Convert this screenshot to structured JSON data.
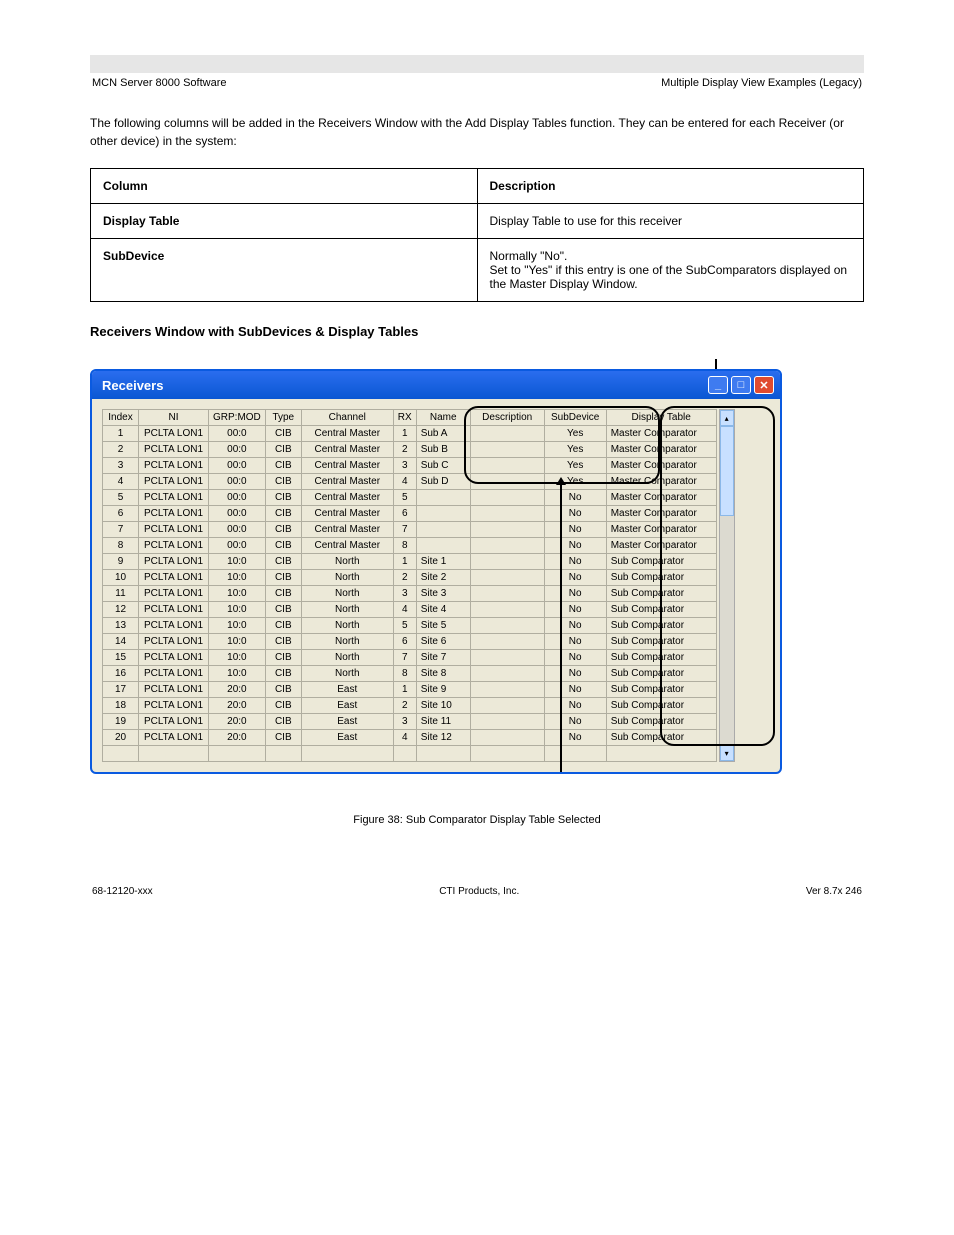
{
  "header": {
    "left": "MCN Server 8000 Software",
    "right": "Multiple Display View Examples (Legacy)"
  },
  "intro": "The following columns will be added in the Receivers Window with the Add Display Tables function. They can be entered for each Receiver (or other device) in the system:",
  "defs": {
    "head_col": "Column",
    "head_desc": "Description",
    "rows": [
      {
        "col": "Display Table",
        "desc": "Display Table to use for this receiver"
      },
      {
        "col": "SubDevice",
        "desc": "Normally \"No\".\nSet to \"Yes\" if this entry is one of the SubComparators displayed on the Master Display Window."
      }
    ]
  },
  "window": {
    "title": "Receivers",
    "columns": [
      "Index",
      "NI",
      "GRP:MOD",
      "Type",
      "Channel",
      "RX",
      "Name",
      "Description",
      "SubDevice",
      "Display Table"
    ],
    "rows": [
      {
        "idx": "1",
        "ni": "PCLTA LON1",
        "grp": "00:0",
        "type": "CIB",
        "ch": "Central Master",
        "rx": "1",
        "name": "Sub A",
        "desc": "",
        "sub": "Yes",
        "disp": "Master Comparator"
      },
      {
        "idx": "2",
        "ni": "PCLTA LON1",
        "grp": "00:0",
        "type": "CIB",
        "ch": "Central Master",
        "rx": "2",
        "name": "Sub B",
        "desc": "",
        "sub": "Yes",
        "disp": "Master Comparator"
      },
      {
        "idx": "3",
        "ni": "PCLTA LON1",
        "grp": "00:0",
        "type": "CIB",
        "ch": "Central Master",
        "rx": "3",
        "name": "Sub C",
        "desc": "",
        "sub": "Yes",
        "disp": "Master Comparator"
      },
      {
        "idx": "4",
        "ni": "PCLTA LON1",
        "grp": "00:0",
        "type": "CIB",
        "ch": "Central Master",
        "rx": "4",
        "name": "Sub D",
        "desc": "",
        "sub": "Yes",
        "disp": "Master Comparator"
      },
      {
        "idx": "5",
        "ni": "PCLTA LON1",
        "grp": "00:0",
        "type": "CIB",
        "ch": "Central Master",
        "rx": "5",
        "name": "",
        "desc": "",
        "sub": "No",
        "disp": "Master Comparator"
      },
      {
        "idx": "6",
        "ni": "PCLTA LON1",
        "grp": "00:0",
        "type": "CIB",
        "ch": "Central Master",
        "rx": "6",
        "name": "",
        "desc": "",
        "sub": "No",
        "disp": "Master Comparator"
      },
      {
        "idx": "7",
        "ni": "PCLTA LON1",
        "grp": "00:0",
        "type": "CIB",
        "ch": "Central Master",
        "rx": "7",
        "name": "",
        "desc": "",
        "sub": "No",
        "disp": "Master Comparator"
      },
      {
        "idx": "8",
        "ni": "PCLTA LON1",
        "grp": "00:0",
        "type": "CIB",
        "ch": "Central Master",
        "rx": "8",
        "name": "",
        "desc": "",
        "sub": "No",
        "disp": "Master Comparator"
      },
      {
        "idx": "9",
        "ni": "PCLTA LON1",
        "grp": "10:0",
        "type": "CIB",
        "ch": "North",
        "rx": "1",
        "name": "Site 1",
        "desc": "",
        "sub": "No",
        "disp": "Sub Comparator"
      },
      {
        "idx": "10",
        "ni": "PCLTA LON1",
        "grp": "10:0",
        "type": "CIB",
        "ch": "North",
        "rx": "2",
        "name": "Site 2",
        "desc": "",
        "sub": "No",
        "disp": "Sub Comparator"
      },
      {
        "idx": "11",
        "ni": "PCLTA LON1",
        "grp": "10:0",
        "type": "CIB",
        "ch": "North",
        "rx": "3",
        "name": "Site 3",
        "desc": "",
        "sub": "No",
        "disp": "Sub Comparator"
      },
      {
        "idx": "12",
        "ni": "PCLTA LON1",
        "grp": "10:0",
        "type": "CIB",
        "ch": "North",
        "rx": "4",
        "name": "Site 4",
        "desc": "",
        "sub": "No",
        "disp": "Sub Comparator"
      },
      {
        "idx": "13",
        "ni": "PCLTA LON1",
        "grp": "10:0",
        "type": "CIB",
        "ch": "North",
        "rx": "5",
        "name": "Site 5",
        "desc": "",
        "sub": "No",
        "disp": "Sub Comparator"
      },
      {
        "idx": "14",
        "ni": "PCLTA LON1",
        "grp": "10:0",
        "type": "CIB",
        "ch": "North",
        "rx": "6",
        "name": "Site 6",
        "desc": "",
        "sub": "No",
        "disp": "Sub Comparator"
      },
      {
        "idx": "15",
        "ni": "PCLTA LON1",
        "grp": "10:0",
        "type": "CIB",
        "ch": "North",
        "rx": "7",
        "name": "Site 7",
        "desc": "",
        "sub": "No",
        "disp": "Sub Comparator"
      },
      {
        "idx": "16",
        "ni": "PCLTA LON1",
        "grp": "10:0",
        "type": "CIB",
        "ch": "North",
        "rx": "8",
        "name": "Site 8",
        "desc": "",
        "sub": "No",
        "disp": "Sub Comparator"
      },
      {
        "idx": "17",
        "ni": "PCLTA LON1",
        "grp": "20:0",
        "type": "CIB",
        "ch": "East",
        "rx": "1",
        "name": "Site 9",
        "desc": "",
        "sub": "No",
        "disp": "Sub Comparator"
      },
      {
        "idx": "18",
        "ni": "PCLTA LON1",
        "grp": "20:0",
        "type": "CIB",
        "ch": "East",
        "rx": "2",
        "name": "Site 10",
        "desc": "",
        "sub": "No",
        "disp": "Sub Comparator"
      },
      {
        "idx": "19",
        "ni": "PCLTA LON1",
        "grp": "20:0",
        "type": "CIB",
        "ch": "East",
        "rx": "3",
        "name": "Site 11",
        "desc": "",
        "sub": "No",
        "disp": "Sub Comparator"
      },
      {
        "idx": "20",
        "ni": "PCLTA LON1",
        "grp": "20:0",
        "type": "CIB",
        "ch": "East",
        "rx": "4",
        "name": "Site 12",
        "desc": "",
        "sub": "No",
        "disp": "Sub Comparator"
      }
    ]
  },
  "subhead": "Receivers Window with SubDevices & Display Tables",
  "figcap": "Figure 38:  Sub Comparator Display Table Selected",
  "footer": {
    "left": "68-12120-xxx",
    "center": "CTI Products, Inc.",
    "right": "Ver 8.7x   246"
  }
}
